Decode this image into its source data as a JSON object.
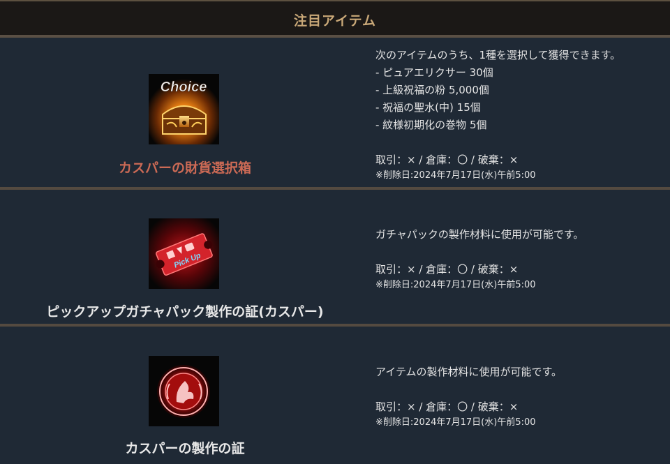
{
  "header": {
    "title": "注目アイテム"
  },
  "items": [
    {
      "name": "カスパーの財貨選択箱",
      "icon": "choice-chest-icon",
      "icon_label": "Choice",
      "description": "次のアイテムのうち、1種を選択して獲得できます。",
      "options": [
        "- ピュアエリクサー 30個",
        "- 上級祝福の粉 5,000個",
        "- 祝福の聖水(中) 15個",
        "- 紋様初期化の巻物 5個"
      ],
      "trade": "取引：× / 倉庫：〇 / 破棄：×",
      "deletion": "※削除日:2024年7月17日(水)午前5:00",
      "name_color": "#cc6a55"
    },
    {
      "name": "ピックアップガチャパック製作の証(カスパー)",
      "icon": "pickup-ticket-icon",
      "icon_label": "Pick Up",
      "description": "ガチャパックの製作材料に使用が可能です。",
      "trade": "取引：× / 倉庫：〇 / 破棄：×",
      "deletion": "※削除日:2024年7月17日(水)午前5:00"
    },
    {
      "name": "カスパーの製作の証",
      "icon": "red-crest-medal-icon",
      "description": "アイテムの製作材料に使用が可能です。",
      "trade": "取引：× / 倉庫：〇 / 破棄：×",
      "deletion": "※削除日:2024年7月17日(水)午前5:00"
    }
  ],
  "colors": {
    "background": "#1f2935",
    "header_text": "#c9a878",
    "divider": "#544a40",
    "featured_name": "#cc6a55"
  }
}
